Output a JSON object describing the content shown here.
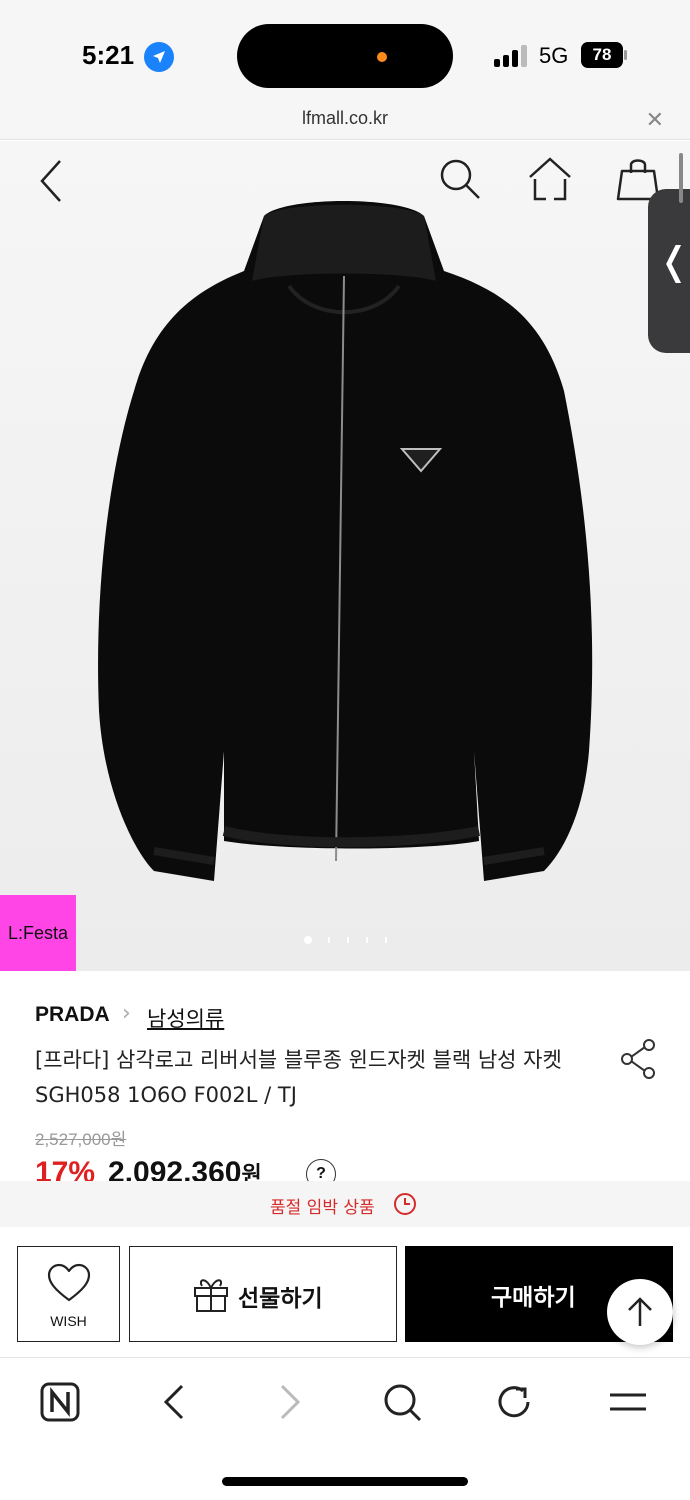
{
  "status_bar": {
    "time": "5:21",
    "network": "5G",
    "battery": "78",
    "location_icon": "location-arrow-icon",
    "activity_color": "#ff8a1c"
  },
  "browser": {
    "url": "lfmall.co.kr",
    "close_icon": "✕"
  },
  "hero": {
    "nav_icons": [
      "back-icon",
      "search-icon",
      "home-icon",
      "shopping-bag-icon"
    ],
    "badge": "L:Festa",
    "badge_color": "#ff45e6",
    "image_count": 5,
    "active_image": 1
  },
  "product": {
    "brand": "PRADA",
    "category": "남성의류",
    "title": "[프라다] 삼각로고 리버서블 블루종 윈드자켓 블랙 남성 자켓 SGH058 1O6O F002L / TJ",
    "original_price": "2,527,000원",
    "discount": "17%",
    "price": "2,092,360",
    "price_unit": "원",
    "help": "?"
  },
  "notice": {
    "text": "품절 임박 상품",
    "color": "#d62b2b"
  },
  "actions": {
    "wish_label": "WISH",
    "gift_label": "선물하기",
    "buy_label": "구매하기"
  },
  "toolbar": {
    "icons": [
      "naver-n-icon",
      "back-arrow-icon",
      "forward-arrow-icon",
      "search-icon",
      "reload-icon",
      "menu-icon"
    ]
  }
}
